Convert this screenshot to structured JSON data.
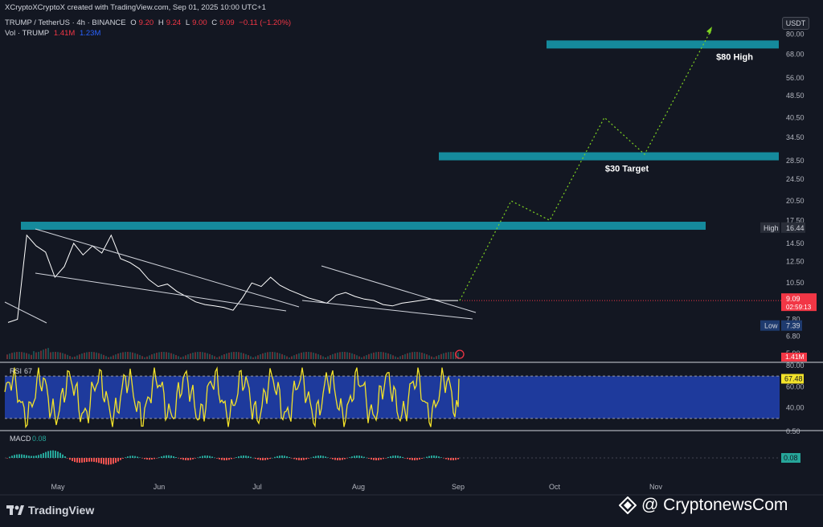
{
  "header": {
    "attribution": "XCryptoXCryptoX created with TradingView.com, Sep 01, 2025 10:00 UTC+1",
    "symbol": "TRUMP / TetherUS · 4h · BINANCE",
    "ohlc": [
      {
        "k": "O",
        "v": "9.20"
      },
      {
        "k": "H",
        "v": "9.24"
      },
      {
        "k": "L",
        "v": "9.00"
      },
      {
        "k": "C",
        "v": "9.09"
      }
    ],
    "change": "−0.11 (−1.20%)",
    "vol_label": "Vol · TRUMP",
    "vol_value": "1.41M",
    "vol_ma": "1.23M"
  },
  "currency_button": "USDT",
  "footer": {
    "platform": "TradingView",
    "watermark": "@ CryptonewsCom"
  },
  "colors": {
    "background": "#131722",
    "zone": "#158a9c",
    "price_up": "#ffffff",
    "rsi_line": "#f2e22a",
    "rsi_band": "#1e3a9c",
    "projection": "#7ed321",
    "macd_up": "#26a69a",
    "macd_down": "#ef5350",
    "price_badge": "#f23645"
  },
  "chart_data": [
    {
      "type": "line",
      "panel": "price",
      "yscale": "log",
      "ylim": [
        5.6,
        88
      ],
      "y_ticks": [
        80.0,
        68.0,
        56.0,
        48.5,
        40.5,
        34.5,
        28.5,
        24.5,
        20.5,
        17.5,
        14.5,
        12.5,
        10.5,
        7.8,
        6.8,
        5.9
      ],
      "x_labels": [
        "May",
        "Jun",
        "Jul",
        "Aug",
        "Sep",
        "Oct",
        "Nov"
      ],
      "price_series": {
        "x": [
          0,
          0.5,
          1,
          1.5,
          2,
          2.5,
          3,
          3.5,
          4,
          4.5,
          5,
          5.5,
          6,
          6.5,
          7,
          7.5,
          8,
          8.5,
          9,
          9.5,
          10,
          10.5,
          11,
          11.5,
          12,
          12.5,
          13,
          13.5,
          14,
          14.5,
          15,
          15.5,
          16,
          16.5,
          17,
          17.5,
          18,
          18.5,
          19,
          19.5,
          20,
          20.5,
          21,
          21.5,
          22,
          22.5,
          23,
          23.5,
          24
        ],
        "y": [
          7.6,
          7.8,
          15.5,
          14.2,
          13.5,
          11.0,
          12.0,
          14.5,
          13.2,
          14.2,
          13.4,
          15.5,
          12.8,
          12.4,
          11.8,
          10.8,
          10.2,
          10.4,
          9.8,
          9.4,
          9.0,
          8.8,
          8.7,
          8.6,
          8.4,
          9.3,
          10.5,
          10.2,
          11.0,
          10.3,
          9.9,
          9.6,
          9.3,
          9.1,
          8.9,
          9.5,
          9.7,
          9.4,
          9.2,
          9.1,
          8.8,
          8.7,
          8.9,
          9.0,
          9.1,
          9.2,
          9.1,
          9.09,
          9.09
        ],
        "x_unit": "4h bars x10 (approx.)"
      },
      "projection": {
        "points": [
          9.09,
          20.5,
          17.5,
          40.5,
          30.0,
          84.0
        ]
      },
      "zones": [
        {
          "label": "",
          "low": 16.4,
          "high": 17.3
        },
        {
          "label": "$30 Target",
          "low": 29.0,
          "high": 30.5
        },
        {
          "label": "$80 High",
          "low": 72.0,
          "high": 76.0
        }
      ],
      "markers": [
        {
          "label": "High",
          "value": "16.44"
        },
        {
          "label": "Low",
          "value": "7.39"
        },
        {
          "label": "",
          "value": "9.09",
          "countdown": "02:59:13"
        }
      ],
      "volume_badge": "1.41M"
    },
    {
      "type": "line",
      "panel": "rsi",
      "title": "RSI",
      "title_value": "67",
      "ylim": [
        20,
        80
      ],
      "y_ticks": [
        80.0,
        60.0,
        40.0
      ],
      "current": "67.48",
      "band": [
        30,
        70
      ]
    },
    {
      "type": "bar",
      "panel": "macd",
      "title": "MACD",
      "title_value": "0.08",
      "y_ticks": [
        0.5
      ],
      "current": "0.08"
    }
  ]
}
